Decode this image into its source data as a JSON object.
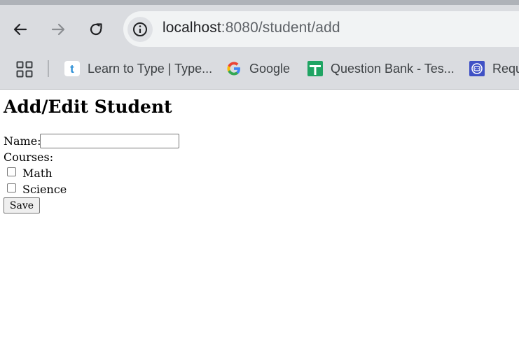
{
  "browser": {
    "url_host": "localhost",
    "url_rest": ":8080/student/add",
    "icons": {
      "back": "arrow-left-icon",
      "forward": "arrow-right-icon",
      "reload": "reload-icon",
      "site_info": "info-icon",
      "apps": "apps-grid-icon"
    },
    "bookmarks": [
      {
        "label": "Learn to Type | Type...",
        "icon": "typing-t-icon"
      },
      {
        "label": "Google",
        "icon": "google-g-icon"
      },
      {
        "label": "Question Bank - Tes...",
        "icon": "sheets-plus-icon"
      },
      {
        "label": "Requ",
        "icon": "robot-icon"
      }
    ]
  },
  "page": {
    "title": "Add/Edit Student",
    "name_label": "Name:",
    "name_value": "",
    "courses_label": "Courses:",
    "courses": [
      {
        "label": "Math",
        "checked": false
      },
      {
        "label": "Science",
        "checked": false
      }
    ],
    "save_label": "Save"
  }
}
